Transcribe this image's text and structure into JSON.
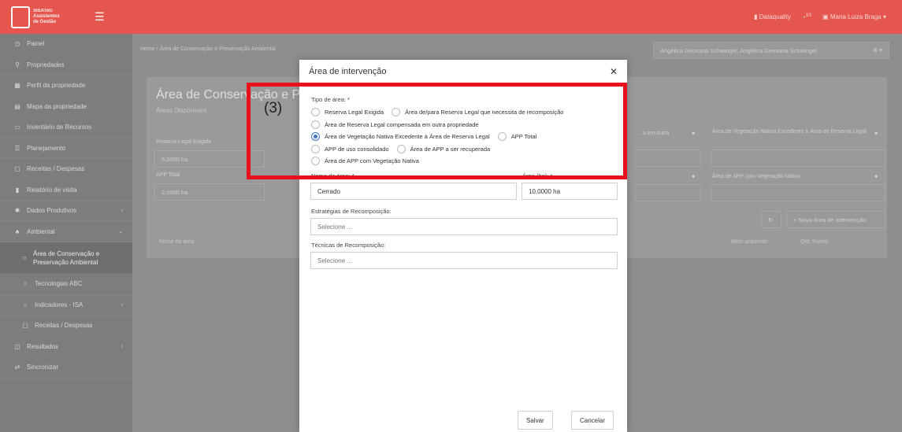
{
  "header": {
    "logo_text": "SISATeG\nAssistentes\nde Gestão",
    "dataquality_label": "Dataquality",
    "notif_count": "10",
    "user_name": "Maria Luiza Braga"
  },
  "sidebar": {
    "items": [
      {
        "label": "Painel",
        "icon": "◷"
      },
      {
        "label": "Propriedades",
        "icon": "⚲"
      },
      {
        "label": "Perfil da propriedade",
        "icon": "▦"
      },
      {
        "label": "Mapa da propriedade",
        "icon": "▤"
      },
      {
        "label": "Inventário de Recursos",
        "icon": "▭"
      },
      {
        "label": "Planejamento",
        "icon": "☰"
      },
      {
        "label": "Receitas / Despesas",
        "icon": "▢"
      },
      {
        "label": "Relatório de visita",
        "icon": "▮"
      },
      {
        "label": "Dados Produtivos",
        "icon": "✱"
      },
      {
        "label": "Ambiental",
        "icon": "♣"
      },
      {
        "label": "Área de Conservação e Preservação Ambiental",
        "icon": "○"
      },
      {
        "label": "Tecnologias ABC",
        "icon": "○"
      },
      {
        "label": "Indicadores - ISA",
        "icon": "○"
      },
      {
        "label": "Receitas / Despesas",
        "icon": "▢"
      },
      {
        "label": "Resultados",
        "icon": "◫"
      },
      {
        "label": "Sincronizar",
        "icon": "⇄"
      }
    ]
  },
  "main": {
    "breadcrumb": "Home / Área de Conservação e Preservação Ambiental",
    "owner_select": "Angélica Geovana Schwingel, Angélica Geovana Schwingel",
    "card_title": "Área de Conservação e Prese",
    "card_subtitle": "Áreas Disponíveis",
    "fields": [
      {
        "label": "Reserva Legal Exigida",
        "value": "5,0000 ha"
      },
      {
        "label": "APP Total",
        "value": "2,0000 ha"
      }
    ],
    "right_labels": {
      "compensada": "...a em outra",
      "vegetacao": "Área de Vegetação Nativa Excedente à Área de Reserva Legal",
      "app_veg": "Área de APP com Vegetação Nativa"
    },
    "new_area_button": "+ Nova área de intervenção",
    "table_headers": [
      "Nome da área",
      "Meio ambiente",
      "Qtd. Rateio"
    ]
  },
  "modal": {
    "title": "Área de intervenção",
    "tipo_label": "Tipo de área: *",
    "options": [
      "Reserva Legal Exigida",
      "Área de/para Reserva Legal que necessita de recomposição",
      "Área de Reserva Legal compensada em outra propriedade",
      "Área de Vegetação Nativa Excedente à Área de Reserva Legal",
      "APP Total",
      "APP de uso consolidado",
      "Área de APP a ser recuperada",
      "Área de APP com Vegetação Nativa"
    ],
    "selected_option": "Área de Vegetação Nativa Excedente à Área de Reserva Legal",
    "nome_label": "Nome da área: *",
    "nome_value": "Cerrado",
    "area_label": "Área (ha): *",
    "area_value": "10,0000 ha",
    "estrategias_label": "Estratégias de Recomposição:",
    "estrategias_placeholder": "Selecione ...",
    "tecnicas_label": "Técnicas de Recomposição:",
    "tecnicas_placeholder": "Selecione ...",
    "save_label": "Salvar",
    "cancel_label": "Cancelar"
  },
  "annotation": {
    "step_label": "(3)",
    "highlight_color": "#e8101a"
  }
}
